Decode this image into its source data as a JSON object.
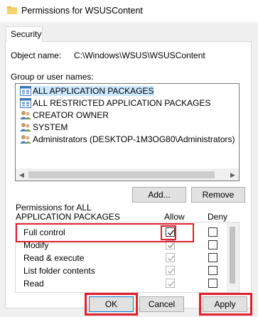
{
  "window": {
    "title": "Permissions for WSUSContent"
  },
  "tabs": [
    {
      "label": "Security"
    }
  ],
  "object": {
    "label": "Object name:",
    "value": "C:\\Windows\\WSUS\\WSUSContent"
  },
  "group": {
    "label": "Group or user names:",
    "items": [
      {
        "label": "ALL APPLICATION PACKAGES",
        "icon": "app-package-icon",
        "selected": true
      },
      {
        "label": "ALL RESTRICTED APPLICATION PACKAGES",
        "icon": "app-package-icon",
        "selected": false
      },
      {
        "label": "CREATOR OWNER",
        "icon": "users-group-icon",
        "selected": false
      },
      {
        "label": "SYSTEM",
        "icon": "users-group-icon",
        "selected": false
      },
      {
        "label": "Administrators (DESKTOP-1M3OG80\\Administrators)",
        "icon": "users-group-icon",
        "selected": false
      }
    ]
  },
  "buttons": {
    "add": "Add...",
    "remove": "Remove",
    "ok": "OK",
    "cancel": "Cancel",
    "apply": "Apply"
  },
  "permissions": {
    "label_line1": "Permissions for ALL",
    "label_line2": "APPLICATION PACKAGES",
    "col_allow": "Allow",
    "col_deny": "Deny",
    "rows": [
      {
        "name": "Full control",
        "allow": "checked",
        "deny": "unchecked"
      },
      {
        "name": "Modify",
        "allow": "checked-grey",
        "deny": "unchecked"
      },
      {
        "name": "Read & execute",
        "allow": "checked-grey",
        "deny": "unchecked"
      },
      {
        "name": "List folder contents",
        "allow": "checked-grey",
        "deny": "unchecked"
      },
      {
        "name": "Read",
        "allow": "checked-grey",
        "deny": "unchecked"
      }
    ]
  },
  "colors": {
    "highlight": "#e0202e",
    "selection": "#cce8ff",
    "accent": "#0078d7"
  }
}
